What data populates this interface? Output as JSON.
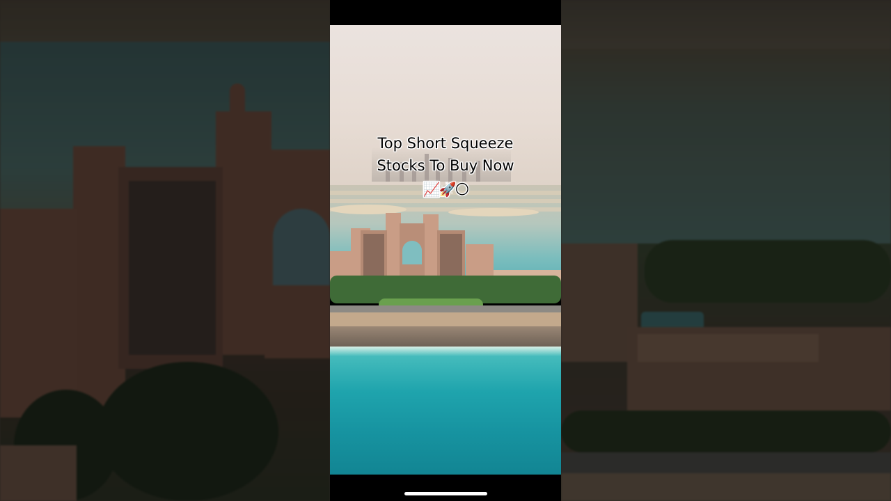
{
  "caption": {
    "line1": "Top Short Squeeze",
    "line2": "Stocks To Buy Now",
    "emojis": "📈🚀🌕"
  },
  "icons": [
    "chart-increasing-icon",
    "rocket-icon",
    "full-moon-icon",
    "home-indicator"
  ],
  "colors": {
    "sea": "#1fa4ad",
    "hotel": "#c99d86",
    "sky": "#ebe3df",
    "letterbox": "#000000"
  }
}
